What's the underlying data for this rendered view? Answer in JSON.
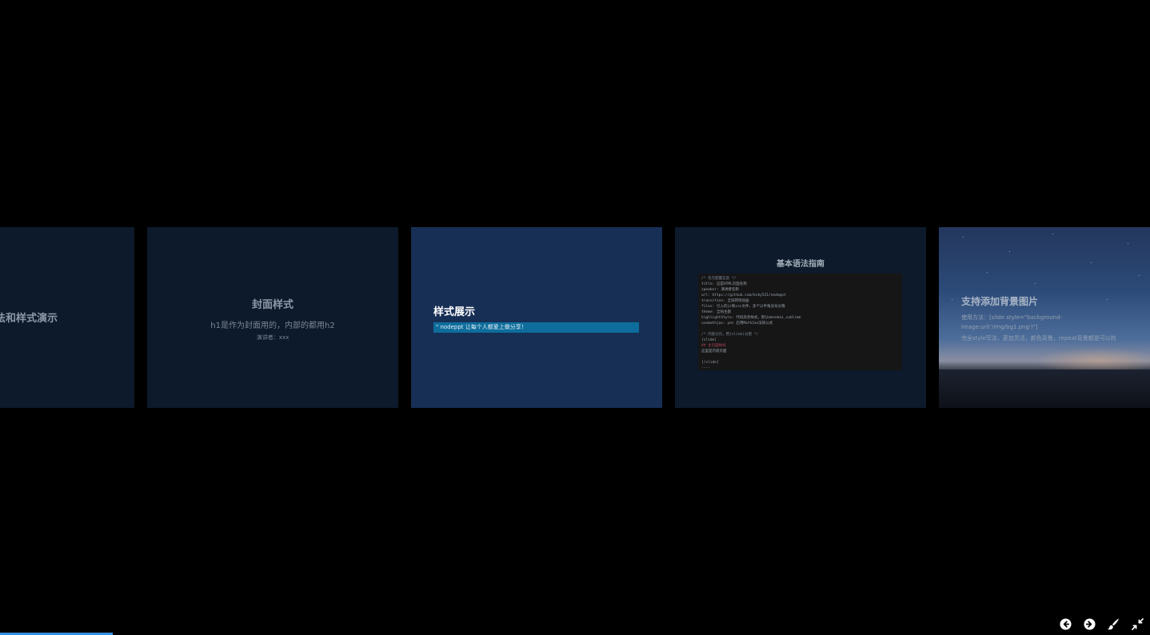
{
  "slides": [
    {
      "title": "语法和样式演示",
      "visible_title": "法和样式演示"
    },
    {
      "title": "封面样式",
      "subtitle": "h1是作为封面用的，内部的都用h2",
      "presenter": "演讲者：xxx"
    },
    {
      "title": "样式展示",
      "quote": "\" nodeppt 让每个人都爱上做分享！"
    },
    {
      "title": "基本语法指南",
      "code_lines": [
        "/* 先写配置信息 */",
        "title: 这是HTML页面名称",
        "speaker: 演讲者名称",
        "url: https://github.com/ksky521/nodeppt",
        "transition: 全局转场动画",
        "files: 引入的js和css文件，多个以半角逗号分隔",
        "theme: 全局主题",
        "highlightStyle: 代码高亮样式，默认monokai_sublime",
        "usemathjax: yes 启用MathJax渲染公式",
        "",
        "/* 内容分页，用[slide]分割 */",
        "[slide]",
        "## 主页面样式",
        "这里是内容页面",
        "",
        "[/slide]",
        "----"
      ]
    },
    {
      "title": "支持添加背景图片",
      "lines": [
        "使用方法：[slide style=\"background-",
        "image:url('/img/bg1.png')\"]",
        "完全style写法，更加灵活，颜色背景，repeat背景都是可以的"
      ]
    }
  ],
  "controls": {
    "prev": "arrow-left",
    "next": "arrow-right",
    "paint": "brush",
    "exit_overview": "compress"
  },
  "progress": {
    "fraction": 0.098,
    "color": "#3a8fe0"
  }
}
